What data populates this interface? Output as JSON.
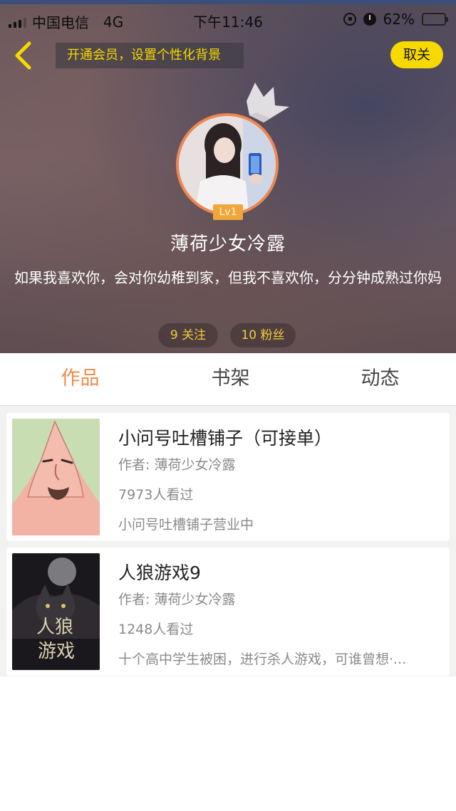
{
  "status_bar": {
    "carrier": "中国电信",
    "network": "4G",
    "time": "下午11:46",
    "battery": "62%",
    "battery_level": 0.62
  },
  "nav": {
    "member_banner": "开通会员，设置个性化背景",
    "close_label": "取关"
  },
  "profile": {
    "level": "Lv1",
    "username": "薄荷少女冷露",
    "bio": "如果我喜欢你，会对你幼稚到家，但我不喜欢你，分分钟成熟过你妈",
    "follow_stat": "9 关注",
    "fans_stat": "10 粉丝"
  },
  "tabs": [
    {
      "label": "作品",
      "active": true
    },
    {
      "label": "书架",
      "active": false
    },
    {
      "label": "动态",
      "active": false
    }
  ],
  "works": [
    {
      "title": "小问号吐槽铺子（可接单）",
      "author": "作者: 薄荷少女冷露",
      "views": "7973人看过",
      "description": "小问号吐槽铺子营业中"
    },
    {
      "title": "人狼游戏9",
      "author": "作者: 薄荷少女冷露",
      "views": "1248人看过",
      "description": "十个高中学生被困，进行杀人游戏，可谁曾想·...",
      "cover_text": "人狼游戏"
    }
  ],
  "colors": {
    "accent_orange": "#f08a4b",
    "accent_yellow": "#f6d900",
    "level_badge": "#f0a63a"
  }
}
